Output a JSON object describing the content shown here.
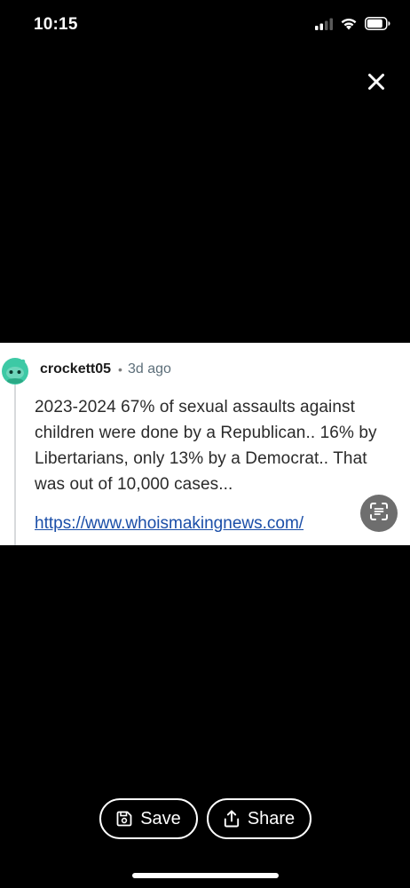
{
  "status_bar": {
    "time": "10:15",
    "icons": [
      "cellular-signal-icon",
      "wifi-icon",
      "battery-icon"
    ]
  },
  "viewer": {
    "close_icon": "close-icon"
  },
  "comment": {
    "username": "crockett05",
    "separator": "•",
    "age": "3d ago",
    "body": "2023-2024 67% of sexual assaults against children were done by a Republican.. 16% by Libertarians, only 13% by a Democrat.. That was out of 10,000 cases...",
    "link": "https://www.whoismakingnews.com/",
    "avatar_color": "#3dc9a5"
  },
  "actions": {
    "save_label": "Save",
    "share_label": "Share"
  },
  "colors": {
    "background": "#000000",
    "card": "#ffffff",
    "link": "#1a4ea8"
  }
}
